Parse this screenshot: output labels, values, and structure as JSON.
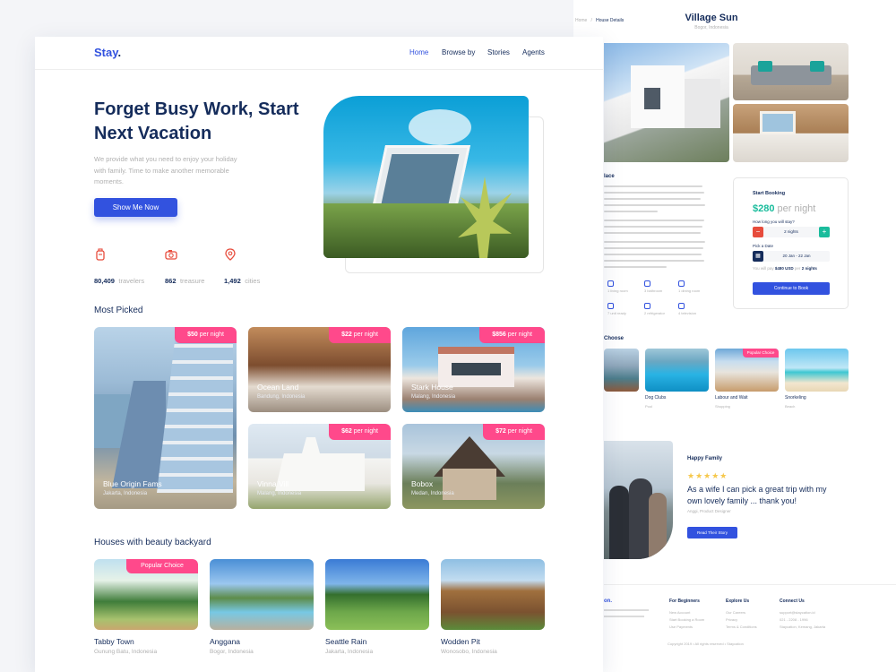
{
  "details": {
    "breadcrumb": [
      "Home",
      "House Details"
    ],
    "title": "Village Sun",
    "subtitle": "Bogor, Indonesia",
    "about_heading": "lace",
    "booking": {
      "title": "Start Booking",
      "price": "$280",
      "per": "per night",
      "stay_question": "How long you will stay?",
      "nights_value": "2 nights",
      "minus": "−",
      "plus": "+",
      "date_label": "Pick a Date",
      "date_value": "20 Jan - 22 Jan",
      "pay_prefix": "You will pay",
      "pay_amount": "$480 USD",
      "pay_per": "per",
      "pay_nights": "2 nights",
      "button": "Continue to Book"
    },
    "amenities": [
      {
        "label": "1 living room"
      },
      {
        "label": "3 bathroom"
      },
      {
        "label": "1 dining room"
      },
      {
        "label": "7 unit ready"
      },
      {
        "label": "2 refrigerator"
      },
      {
        "label": "4 television"
      }
    ],
    "treasure_heading": "Choose",
    "treasures": [
      {
        "name": "",
        "sub": ""
      },
      {
        "name": "Dog Clubs",
        "sub": "Pool"
      },
      {
        "name": "Labour and Wait",
        "sub": "Shopping",
        "badge": "Popular Choice"
      },
      {
        "name": "Snorkeling",
        "sub": "Beach"
      }
    ],
    "testimonial": {
      "heading": "Happy Family",
      "stars": "★★★★★",
      "quote": "As a wife I can pick a great trip with my own lovely family ... thank you!",
      "author": "Anggi, Product Designer",
      "button": "Read Their Story"
    },
    "footer": {
      "brand": "on.",
      "columns": [
        {
          "title": "For Beginners",
          "items": [
            "New Account",
            "Start Booking a Room",
            "Use Payments"
          ]
        },
        {
          "title": "Explore Us",
          "items": [
            "Our Careers",
            "Privacy",
            "Terms & Conditions"
          ]
        },
        {
          "title": "Connect Us",
          "items": [
            "support@staycation.id",
            "021 - 2208 - 1996",
            "Staycation, Kemang, Jakarta"
          ]
        }
      ],
      "copyright": "Copyright 2019 • All rights reserved • Staycation"
    }
  },
  "home": {
    "logo_main": "Stay",
    "logo_dot": ".",
    "nav": [
      "Home",
      "Browse by",
      "Stories",
      "Agents"
    ],
    "hero": {
      "title": "Forget Busy Work, Start Next Vacation",
      "description": "We provide what you need to enjoy your holiday with family. Time to make another memorable moments.",
      "button": "Show Me Now"
    },
    "stats": [
      {
        "icon": "traveler-icon",
        "value": "80,409",
        "label": "travelers"
      },
      {
        "icon": "camera-icon",
        "value": "862",
        "label": "treasure"
      },
      {
        "icon": "location-icon",
        "value": "1,492",
        "label": "cities"
      }
    ],
    "most_picked_heading": "Most Picked",
    "most_picked": [
      {
        "price": "$50",
        "per": "per night",
        "name": "Blue Origin Fams",
        "location": "Jakarta, Indonesia"
      },
      {
        "price": "$22",
        "per": "per night",
        "name": "Ocean Land",
        "location": "Bandung, Indonesia"
      },
      {
        "price": "$856",
        "per": "per night",
        "name": "Stark House",
        "location": "Malang, Indonesia"
      },
      {
        "price": "$62",
        "per": "per night",
        "name": "Vinna Vill",
        "location": "Malang, Indonesia"
      },
      {
        "price": "$72",
        "per": "per night",
        "name": "Bobox",
        "location": "Medan, Indonesia"
      }
    ],
    "backyard_heading": "Houses with beauty backyard",
    "backyard": [
      {
        "name": "Tabby Town",
        "location": "Gunung Batu, Indonesia",
        "badge": "Popular Choice"
      },
      {
        "name": "Anggana",
        "location": "Bogor, Indonesia"
      },
      {
        "name": "Seattle Rain",
        "location": "Jakarta, Indonesia"
      },
      {
        "name": "Wodden Pit",
        "location": "Wonosobo, Indonesia"
      }
    ]
  }
}
